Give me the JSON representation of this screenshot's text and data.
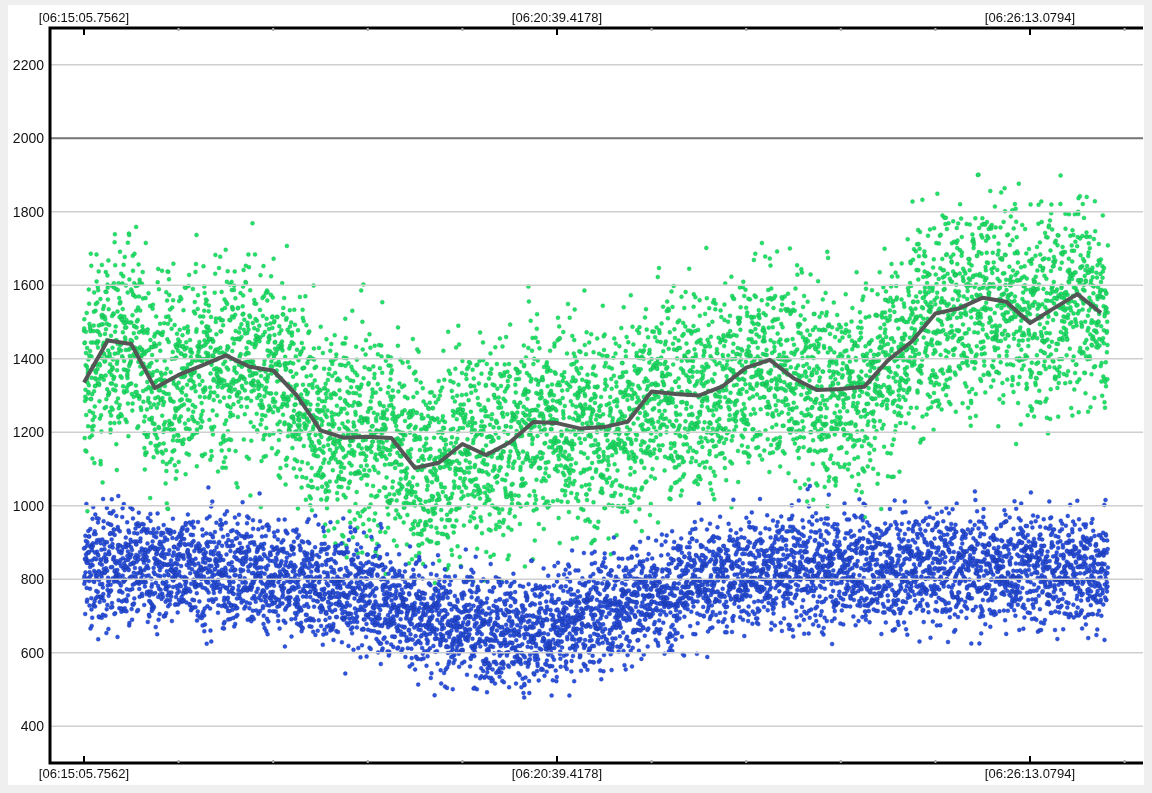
{
  "chart": {
    "top_labels": [
      "[06:15:05.7562]",
      "[06:20:39.4178]",
      "[06:26:13.0794]"
    ],
    "chart_data": {
      "type": "line",
      "categories": [
        "[06:15:05.7562]",
        null,
        null,
        null,
        null,
        null,
        null,
        null,
        null,
        null,
        null,
        null,
        null,
        null,
        null,
        null,
        null,
        null,
        null,
        null,
        "[06:20:39.4178]",
        null,
        null,
        null,
        null,
        null,
        null,
        null,
        null,
        null,
        null,
        null,
        null,
        null,
        null,
        null,
        null,
        null,
        null,
        null,
        "[06:26:13.0794]",
        null,
        null,
        null
      ],
      "series": [
        {
          "color": "#555555",
          "values": [
            1335,
            1450,
            1440,
            1320,
            1356,
            1382,
            1409,
            1378,
            1368,
            1300,
            1205,
            1185,
            1188,
            1184,
            1103,
            1117,
            1168,
            1138,
            1172,
            1228,
            1225,
            1210,
            1214,
            1229,
            1311,
            1304,
            1300,
            1325,
            1376,
            1397,
            1347,
            1315,
            1318,
            1324,
            1396,
            1447,
            1523,
            1537,
            1566,
            1555,
            1497,
            1537,
            1576,
            1525
          ]
        }
      ],
      "grid": true,
      "ref_lines": [
        {
          "axis": "y",
          "value": 2000
        }
      ],
      "ylim": [
        300,
        2300
      ],
      "yticks": [
        400,
        600,
        800,
        1000,
        1200,
        1400,
        1600,
        1800,
        2000,
        2200
      ]
    }
  }
}
